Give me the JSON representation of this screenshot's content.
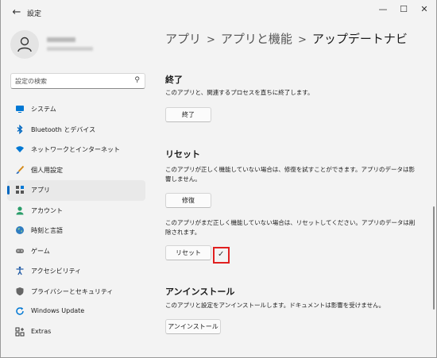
{
  "window": {
    "title": "設定",
    "back_glyph": "←",
    "minimize_glyph": "—",
    "maximize_glyph": "☐",
    "close_glyph": "✕"
  },
  "sidebar": {
    "search_placeholder": "設定の検索",
    "items": [
      {
        "label": "システム",
        "icon": "monitor-icon",
        "color": "#0078d4",
        "active": false
      },
      {
        "label": "Bluetooth とデバイス",
        "icon": "bluetooth-icon",
        "color": "#0067c0",
        "active": false
      },
      {
        "label": "ネットワークとインターネット",
        "icon": "wifi-icon",
        "color": "#0078d4",
        "active": false
      },
      {
        "label": "個人用設定",
        "icon": "brush-icon",
        "color": "#d48a1a",
        "active": false
      },
      {
        "label": "アプリ",
        "icon": "apps-icon",
        "color": "#555555",
        "active": true
      },
      {
        "label": "アカウント",
        "icon": "person-icon",
        "color": "#2a9d6a",
        "active": false
      },
      {
        "label": "時刻と言語",
        "icon": "globe-icon",
        "color": "#2f7dc0",
        "active": false
      },
      {
        "label": "ゲーム",
        "icon": "gamepad-icon",
        "color": "#777777",
        "active": false
      },
      {
        "label": "アクセシビリティ",
        "icon": "accessibility-icon",
        "color": "#1f5aa6",
        "active": false
      },
      {
        "label": "プライバシーとセキュリティ",
        "icon": "shield-icon",
        "color": "#666666",
        "active": false
      },
      {
        "label": "Windows Update",
        "icon": "update-icon",
        "color": "#0078d4",
        "active": false
      },
      {
        "label": "Extras",
        "icon": "extras-icon",
        "color": "#333333",
        "active": false
      }
    ]
  },
  "breadcrumb": {
    "level1": "アプリ",
    "level2": "アプリと機能",
    "current": "アップデートナビ",
    "separator": ">"
  },
  "sections": {
    "terminate": {
      "title": "終了",
      "description": "このアプリと、関連するプロセスを直ちに終了します。",
      "button": "終了"
    },
    "reset": {
      "title": "リセット",
      "repair_description": "このアプリが正しく機能していない場合は、修復を試すことができます。アプリのデータは影響しません。",
      "repair_button": "修復",
      "reset_description": "このアプリがまだ正しく機能していない場合は、リセットしてください。アプリのデータは削除されます。",
      "reset_button": "リセット",
      "check_glyph": "✓"
    },
    "uninstall": {
      "title": "アンインストール",
      "description": "このアプリと設定をアンインストールします。ドキュメントは影響を受けません。",
      "button": "アンインストール"
    }
  },
  "colors": {
    "accent": "#0067c0",
    "highlight_box": "#e02020"
  }
}
